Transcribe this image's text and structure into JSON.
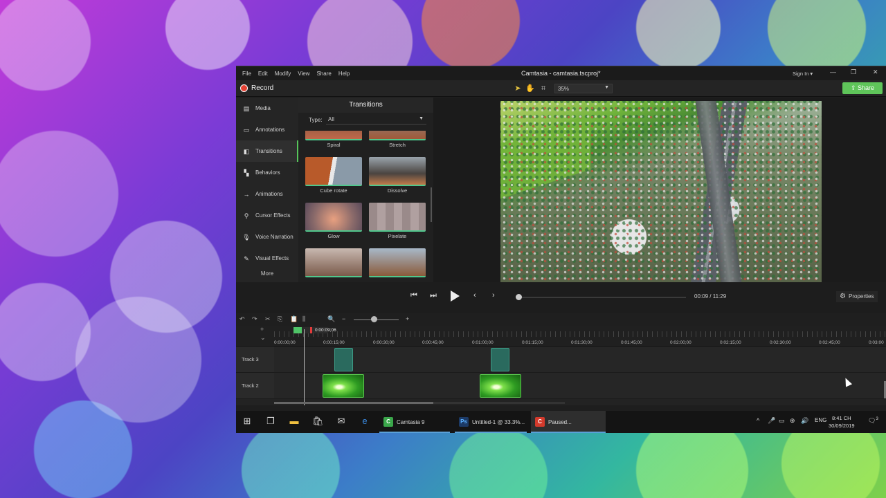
{
  "window": {
    "menu": [
      "File",
      "Edit",
      "Modify",
      "View",
      "Share",
      "Help"
    ],
    "title": "Camtasia - camtasia.tscproj*",
    "sign_in": "Sign In ▾",
    "minimize": "—",
    "restore": "❐",
    "close": "✕"
  },
  "toolbar": {
    "record_label": "Record",
    "zoom": "35%",
    "share_label": "Share"
  },
  "leftnav": {
    "items": [
      {
        "label": "Media",
        "icon": "media-icon"
      },
      {
        "label": "Annotations",
        "icon": "annotations-icon"
      },
      {
        "label": "Transitions",
        "icon": "transitions-icon"
      },
      {
        "label": "Behaviors",
        "icon": "behaviors-icon"
      },
      {
        "label": "Animations",
        "icon": "animations-icon"
      },
      {
        "label": "Cursor Effects",
        "icon": "cursor-effects-icon"
      },
      {
        "label": "Voice Narration",
        "icon": "microphone-icon"
      },
      {
        "label": "Visual Effects",
        "icon": "visual-effects-icon"
      }
    ],
    "more": "More"
  },
  "panel": {
    "title": "Transitions",
    "type_label": "Type:",
    "type_value": "All",
    "tiles": [
      "Spiral",
      "Stretch",
      "Cube rotate",
      "Dissolve",
      "Glow",
      "Pixelate",
      "",
      ""
    ]
  },
  "playback": {
    "current": "00:09",
    "separator": "/",
    "total": "11:29",
    "properties": "Properties"
  },
  "timeline": {
    "playhead_time": "0:00:09;06",
    "ruler": [
      "0:00:00;00",
      "0:00:15;00",
      "0:00:30;00",
      "0:00:45;00",
      "0:01:00;00",
      "0:01:15;00",
      "0:01:30;00",
      "0:01:45;00",
      "0:02:00;00",
      "0:02:15;00",
      "0:02:30;00",
      "0:02:45;00",
      "0:03:00"
    ],
    "tracks": [
      "Track 3",
      "Track 2"
    ]
  },
  "taskbar": {
    "apps": [
      {
        "label": "Camtasia 9",
        "badge": "C",
        "color": "#3aa64a"
      },
      {
        "label": "Untitled-1 @ 33.3%...",
        "badge": "Ps",
        "color": "#1c3a66"
      },
      {
        "label": "Paused...",
        "badge": "C",
        "color": "#d33a2c"
      }
    ],
    "lang": "ENG",
    "time": "8:41 CH",
    "date": "30/09/2019",
    "notifications": "3"
  }
}
